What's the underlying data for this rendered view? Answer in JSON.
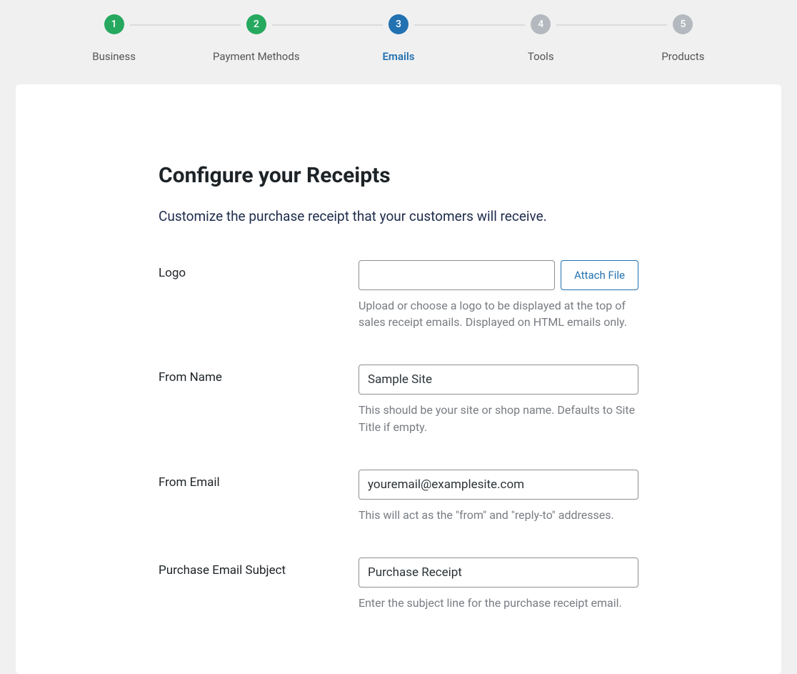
{
  "stepper": {
    "steps": [
      {
        "num": "1",
        "label": "Business",
        "state": "completed"
      },
      {
        "num": "2",
        "label": "Payment Methods",
        "state": "completed"
      },
      {
        "num": "3",
        "label": "Emails",
        "state": "active"
      },
      {
        "num": "4",
        "label": "Tools",
        "state": "inactive"
      },
      {
        "num": "5",
        "label": "Products",
        "state": "inactive"
      }
    ]
  },
  "page": {
    "title": "Configure your Receipts",
    "subtitle": "Customize the purchase receipt that your customers will receive."
  },
  "fields": {
    "logo": {
      "label": "Logo",
      "value": "",
      "attach_label": "Attach File",
      "help": "Upload or choose a logo to be displayed at the top of sales receipt emails. Displayed on HTML emails only."
    },
    "from_name": {
      "label": "From Name",
      "value": "Sample Site",
      "help": "This should be your site or shop name. Defaults to Site Title if empty."
    },
    "from_email": {
      "label": "From Email",
      "value": "youremail@examplesite.com",
      "help": "This will act as the \"from\" and \"reply-to\" addresses."
    },
    "purchase_subject": {
      "label": "Purchase Email Subject",
      "value": "Purchase Receipt",
      "help": "Enter the subject line for the purchase receipt email."
    }
  }
}
